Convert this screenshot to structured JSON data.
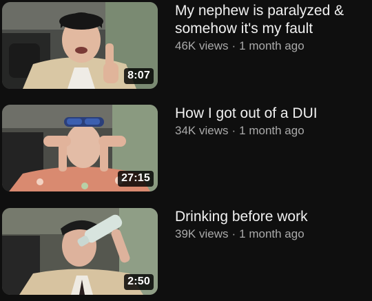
{
  "videos": [
    {
      "title": "My nephew is paralyzed & somehow it's my fault",
      "views": "46K views",
      "separator": "·",
      "age": "1 month ago",
      "duration": "8:07"
    },
    {
      "title": "How I got out of a DUI",
      "views": "34K views",
      "separator": "·",
      "age": "1 month ago",
      "duration": "27:15"
    },
    {
      "title": "Drinking before work",
      "views": "39K views",
      "separator": "·",
      "age": "1 month ago",
      "duration": "2:50"
    }
  ]
}
